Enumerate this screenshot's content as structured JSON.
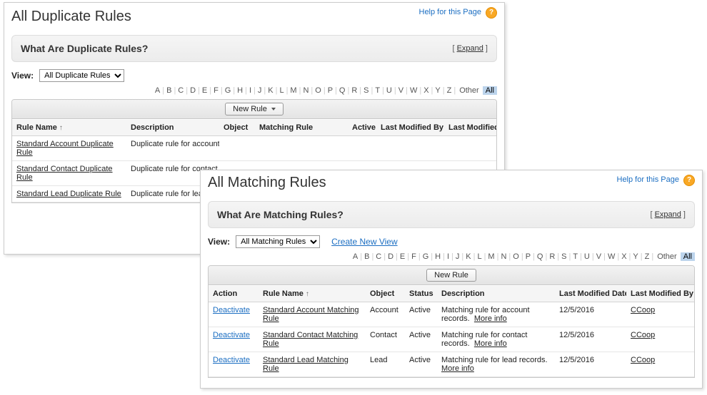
{
  "alphabet": [
    "A",
    "B",
    "C",
    "D",
    "E",
    "F",
    "G",
    "H",
    "I",
    "J",
    "K",
    "L",
    "M",
    "N",
    "O",
    "P",
    "Q",
    "R",
    "S",
    "T",
    "U",
    "V",
    "W",
    "X",
    "Y",
    "Z"
  ],
  "alpha_other": "Other",
  "alpha_all": "All",
  "help_link": "Help for this Page",
  "expand_label": "Expand",
  "view_label": "View:",
  "p1": {
    "title": "All Duplicate Rules",
    "subtitle": "What Are Duplicate Rules?",
    "view_options": [
      "All Duplicate Rules"
    ],
    "new_rule_label": "New Rule",
    "cols": {
      "rule_name": "Rule Name",
      "description": "Description",
      "object": "Object",
      "matching_rule": "Matching Rule",
      "active": "Active",
      "last_mod_by": "Last Modified By",
      "last_mod_date": "Last Modified Date"
    },
    "rows": [
      {
        "name": "Standard Account Duplicate Rule",
        "desc": "Duplicate rule for account records."
      },
      {
        "name": "Standard Contact Duplicate Rule",
        "desc": "Duplicate rule for contact records."
      },
      {
        "name": "Standard Lead Duplicate Rule",
        "desc": "Duplicate rule for lead records."
      }
    ]
  },
  "p2": {
    "title": "All Matching Rules",
    "subtitle": "What Are Matching Rules?",
    "view_options": [
      "All Matching Rules"
    ],
    "create_view_label": "Create New View",
    "new_rule_label": "New Rule",
    "more_info_label": "More info",
    "cols": {
      "action": "Action",
      "rule_name": "Rule Name",
      "object": "Object",
      "status": "Status",
      "description": "Description",
      "last_mod_date": "Last Modified Date",
      "last_mod_by": "Last Modified By"
    },
    "action_label": "Deactivate",
    "rows": [
      {
        "name": "Standard Account Matching Rule",
        "object": "Account",
        "status": "Active",
        "desc": "Matching rule for account records.",
        "date": "12/5/2016",
        "by": "CCoop"
      },
      {
        "name": "Standard Contact Matching Rule",
        "object": "Contact",
        "status": "Active",
        "desc": "Matching rule for contact records.",
        "date": "12/5/2016",
        "by": "CCoop"
      },
      {
        "name": "Standard Lead Matching Rule",
        "object": "Lead",
        "status": "Active",
        "desc": "Matching rule for lead records.",
        "date": "12/5/2016",
        "by": "CCoop"
      }
    ]
  }
}
